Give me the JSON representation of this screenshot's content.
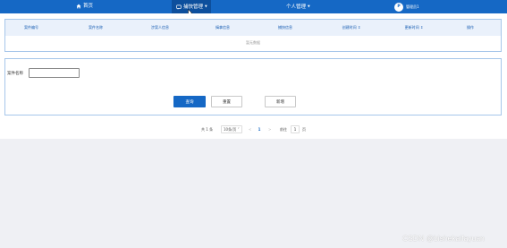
{
  "nav": {
    "home_label": "首页",
    "manage_label": "捕快管理",
    "personal_label": "个人管理",
    "user_label": "管理员1",
    "avatar_text": "P"
  },
  "table": {
    "headers": [
      "案件编号",
      "案件名称",
      "涉案人信息",
      "缉拿信息",
      "捕快信息",
      "创建时间",
      "更新时间",
      "操作"
    ],
    "sortable": [
      false,
      false,
      false,
      false,
      false,
      true,
      true,
      false
    ],
    "empty_text": "暂无数据"
  },
  "form": {
    "label": "案件名称",
    "input_value": "",
    "input_placeholder": "",
    "search_label": "查询",
    "reset_label": "重置",
    "add_label": "新增"
  },
  "pagination": {
    "total_text": "共 1 条",
    "page_size_text": "10条/页",
    "current_page": "1",
    "goto_prefix": "前往",
    "goto_value": "1",
    "goto_suffix": "页"
  },
  "watermark": "CSDN @bishekaifayuan",
  "colors": {
    "primary": "#1568c5",
    "nav_active": "#0d4f9d",
    "background": "#eff0f4",
    "card_border": "#a6c6ea",
    "table_header_bg": "#eaf1fb"
  },
  "icons": {
    "home": "home-icon",
    "manage": "chat-icon",
    "caret": "caret-down-icon",
    "sort": "sort-icon"
  }
}
